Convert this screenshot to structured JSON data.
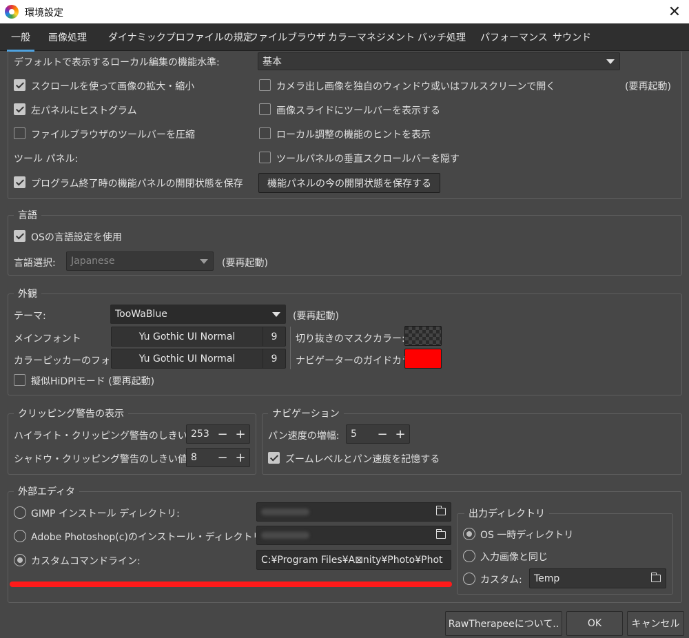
{
  "window": {
    "title": "環境設定",
    "close_glyph": "✕"
  },
  "tabs": [
    "一般",
    "画像処理",
    "ダイナミックプロファイルの規定",
    "ファイルブラウザ",
    "カラーマネジメント",
    "バッチ処理",
    "パフォーマンス",
    "サウンド"
  ],
  "general": {
    "local_edit_label": "デフォルトで表示するローカル編集の機能水準:",
    "local_edit_value": "基本",
    "scroll_zoom": {
      "label": "スクロールを使って画像の拡大・縮小",
      "checked": true
    },
    "histogram_left": {
      "label": "左パネルにヒストグラム",
      "checked": true
    },
    "compact_fb_toolbar": {
      "label": "ファイルブラウザのツールバーを圧縮",
      "checked": false
    },
    "tool_panel_label": "ツール パネル:",
    "save_panel_state": {
      "label": "プログラム終了時の機能パネルの開閉状態を保存",
      "checked": true
    },
    "camera_fullscreen": {
      "label": "カメラ出し画像を独自のウィンドウ或いはフルスクリーンで開く",
      "checked": false
    },
    "restart_note": "(要再起動)",
    "slideshow_toolbar": {
      "label": "画像スライドにツールバーを表示する",
      "checked": false
    },
    "local_hints": {
      "label": "ローカル調整の機能のヒントを表示",
      "checked": false
    },
    "hide_vscroll": {
      "label": "ツールパネルの垂直スクロールバーを隠す",
      "checked": false
    },
    "save_state_button": "機能パネルの今の開閉状態を保存する"
  },
  "language": {
    "title": "言語",
    "use_os": {
      "label": "OSの言語設定を使用",
      "checked": true
    },
    "select_label": "言語選択:",
    "select_value": "Japanese",
    "restart_note": "(要再起動)"
  },
  "appearance": {
    "title": "外観",
    "theme_label": "テーマ:",
    "theme_value": "TooWaBlue",
    "restart_note": "(要再起動)",
    "main_font_label": "メインフォント",
    "main_font_name": "Yu Gothic UI Normal",
    "main_font_size": "9",
    "picker_font_label": "カラーピッカーのフォント:",
    "picker_font_name": "Yu Gothic UI Normal",
    "picker_font_size": "9",
    "crop_mask_label": "切り抜きのマスクカラー:",
    "nav_guide_label": "ナビゲーターのガイドカラー:",
    "nav_guide_color": "#ff0000",
    "pseudo_hidpi": {
      "label": "擬似HiDPIモード (要再起動)",
      "checked": false
    }
  },
  "clipping": {
    "title": "クリッピング警告の表示",
    "highlight_label": "ハイライト・クリッピング警告のしきい値:",
    "highlight_value": "253",
    "shadow_label": "シャドウ・クリッピング警告のしきい値:",
    "shadow_value": "8",
    "minus": "−",
    "plus": "+"
  },
  "navigation": {
    "title": "ナビゲーション",
    "pan_label": "パン速度の増幅:",
    "pan_value": "5",
    "remember": {
      "label": "ズームレベルとパン速度を記憶する",
      "checked": true
    }
  },
  "external_editor": {
    "title": "外部エディタ",
    "options": [
      {
        "label": "GIMP インストール ディレクトリ:",
        "selected": false,
        "path": ""
      },
      {
        "label": "Adobe Photoshop(c)のインストール・ディレクトリ:",
        "selected": false,
        "path": ""
      },
      {
        "label": "カスタムコマンドライン:",
        "selected": true,
        "path": "C:¥Program Files¥A⊠nity¥Photo¥Phot"
      }
    ],
    "highlight_color": "#ff1a1a"
  },
  "output_dir": {
    "title": "出力ディレクトリ",
    "os_temp": {
      "label": "OS 一時ディレクトリ",
      "selected": true
    },
    "same_as_input": {
      "label": "入力画像と同じ",
      "selected": false
    },
    "custom": {
      "label": "カスタム:",
      "selected": false,
      "path": "Temp"
    }
  },
  "footer": {
    "about": "RawTherapeeについて..",
    "ok": "OK",
    "cancel": "キャンセル"
  }
}
